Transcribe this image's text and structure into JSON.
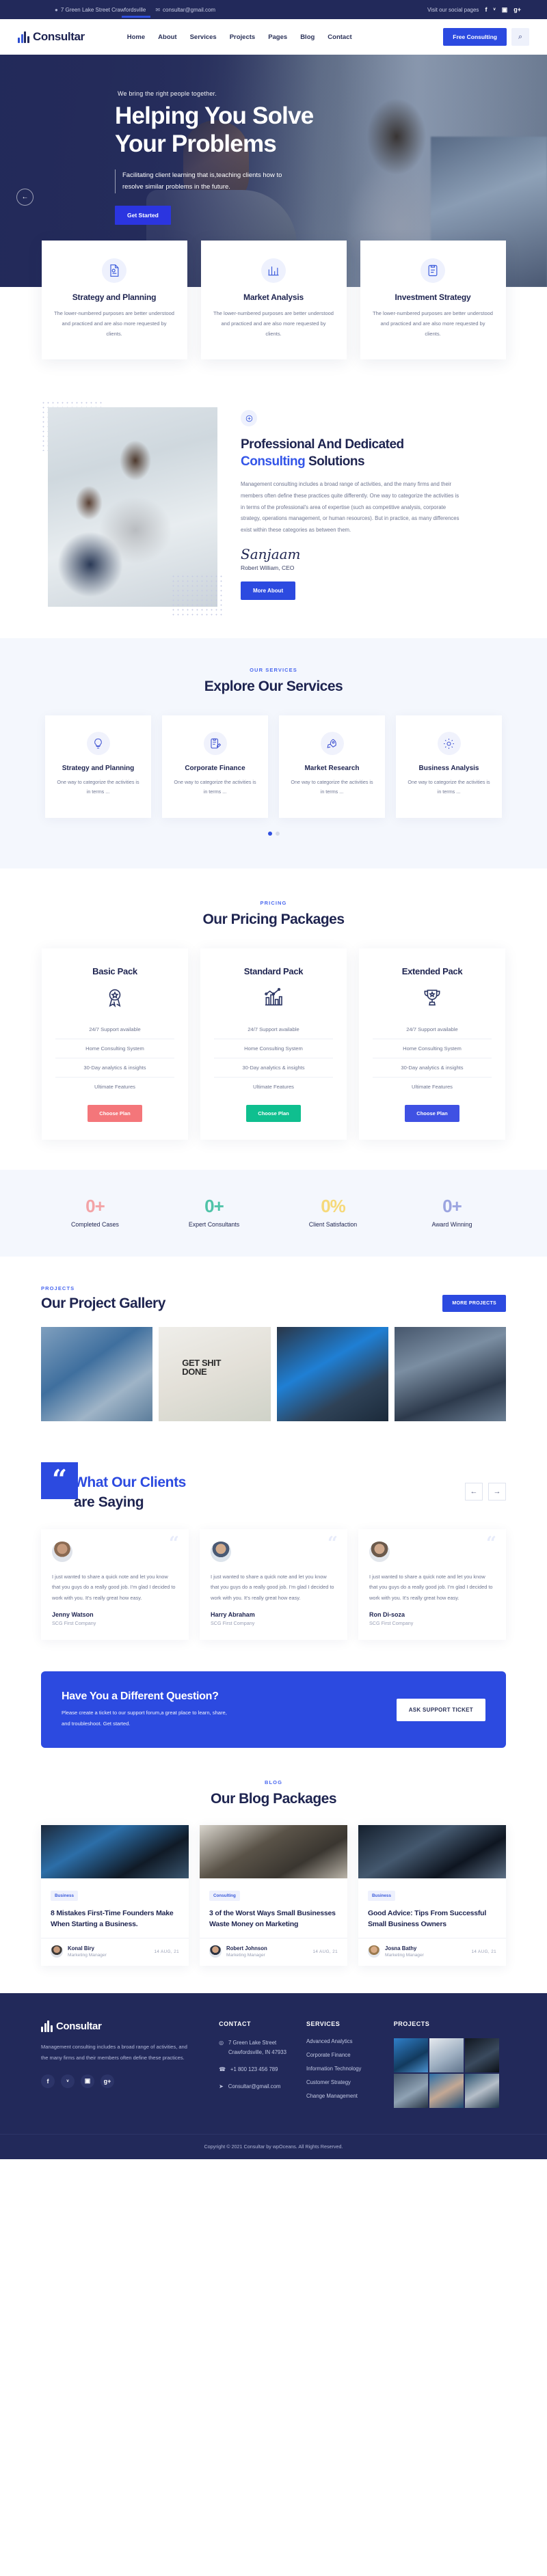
{
  "topbar": {
    "address": "7 Green Lake Street Crawfordsville",
    "email": "consultar@gmail.com",
    "social_label": "Visit our social pages",
    "social": [
      "f",
      "ᵛ",
      "▣",
      "g+"
    ]
  },
  "header": {
    "brand": "Consultar",
    "nav": [
      {
        "label": "Home",
        "active": true
      },
      {
        "label": "About",
        "active": false
      },
      {
        "label": "Services",
        "active": false
      },
      {
        "label": "Projects",
        "active": false
      },
      {
        "label": "Pages",
        "active": false
      },
      {
        "label": "Blog",
        "active": false
      },
      {
        "label": "Contact",
        "active": false
      }
    ],
    "cta": "Free Consulting",
    "search_icon": "⌕"
  },
  "hero": {
    "subtitle": "We bring the right people together.",
    "title_line1": "Helping You Solve",
    "title_line2": "Your Problems",
    "description": "Facilitating client learning that is,teaching clients how to resolve similar problems in the future.",
    "button": "Get Started",
    "prev_arrow": "←"
  },
  "features": [
    {
      "title": "Strategy and Planning",
      "text": "The lower-numbered purposes are better understood and practiced and are also more requested by clients.",
      "icon": "document-chart-icon"
    },
    {
      "title": "Market Analysis",
      "text": "The lower-numbered purposes are better understood and practiced and are also more requested by clients.",
      "icon": "bar-chart-icon"
    },
    {
      "title": "Investment Strategy",
      "text": "The lower-numbered purposes are better understood and practiced and are also more requested by clients.",
      "icon": "clipboard-icon"
    }
  ],
  "about": {
    "title_plain1": "Professional And Dedicated",
    "title_highlight": "Consulting",
    "title_plain2": " Solutions",
    "paragraph": "Management consulting includes a broad range of activities, and the many firms and their members often define these practices quite differently. One way to categorize the activities is in terms of the professional's area of expertise (such as competitive analysis, corporate strategy, operations management, or human resources). But in practice, as many differences exist within these categories as between them.",
    "signature": "Sanjaam",
    "signature_name": "Robert William, CEO",
    "button": "More About"
  },
  "services": {
    "eyebrow": "OUR SERVICES",
    "title": "Explore Our Services",
    "items": [
      {
        "title": "Strategy and Planning",
        "text": "One way to categorize the activities is in terms ...",
        "icon": "lightbulb-icon"
      },
      {
        "title": "Corporate Finance",
        "text": "One way to categorize the activities is in terms ...",
        "icon": "clipboard-pencil-icon"
      },
      {
        "title": "Market Research",
        "text": "One way to categorize the activities is in terms ...",
        "icon": "rocket-icon"
      },
      {
        "title": "Business Analysis",
        "text": "One way to categorize the activities is in terms ...",
        "icon": "gear-icon"
      }
    ]
  },
  "pricing": {
    "eyebrow": "PRICING",
    "title": "Our Pricing Packages",
    "plans": [
      {
        "name": "Basic Pack",
        "icon": "badge-star-icon",
        "features": [
          "24/7 Support available",
          "Home Consulting System",
          "30-Day analytics & insights",
          "Ultimate Features"
        ],
        "button": "Choose Plan",
        "color": "#f4767a"
      },
      {
        "name": "Standard Pack",
        "icon": "bar-chart-line-icon",
        "features": [
          "24/7 Support available",
          "Home Consulting System",
          "30-Day analytics & insights",
          "Ultimate Features"
        ],
        "button": "Choose Plan",
        "color": "#0fbf8f"
      },
      {
        "name": "Extended Pack",
        "icon": "trophy-icon",
        "features": [
          "24/7 Support available",
          "Home Consulting System",
          "30-Day analytics & insights",
          "Ultimate Features"
        ],
        "button": "Choose Plan",
        "color": "#3f51e3"
      }
    ]
  },
  "counters": [
    {
      "value": "0+",
      "label": "Completed Cases",
      "color": "#f3a3a6"
    },
    {
      "value": "0+",
      "label": "Expert Consultants",
      "color": "#4fc3a8"
    },
    {
      "value": "0%",
      "label": "Client Satisfaction",
      "color": "#f6d97a"
    },
    {
      "value": "0+",
      "label": "Award Winning",
      "color": "#9ba4e0"
    }
  ],
  "projects": {
    "eyebrow": "PROJECTS",
    "title": "Our Project Gallery",
    "button": "MORE PROJECTS"
  },
  "testimonials": {
    "quote_glyph": "“",
    "title_hl": "What Our Clients",
    "title_rest": "are Saying",
    "prev": "←",
    "next": "→",
    "items": [
      {
        "quote": "I just wanted to share a quick note and let you know that you guys do a really good job. I'm glad I decided to work with you. It's really great how easy.",
        "name": "Jenny Watson",
        "company": "SCG First Company"
      },
      {
        "quote": "I just wanted to share a quick note and let you know that you guys do a really good job. I'm glad I decided to work with you. It's really great how easy.",
        "name": "Harry Abraham",
        "company": "SCG First Company"
      },
      {
        "quote": "I just wanted to share a quick note and let you know that you guys do a really good job. I'm glad I decided to work with you. It's really great how easy.",
        "name": "Ron Di-soza",
        "company": "SCG First Company"
      }
    ]
  },
  "cta": {
    "title": "Have You a Different Question?",
    "text": "Please create a ticket to our support forum,a great place to learn, share, and troubleshoot. Get started.",
    "button": "ASK SUPPORT TICKET"
  },
  "blog": {
    "eyebrow": "BLOG",
    "title": "Our Blog Packages",
    "posts": [
      {
        "tag": "Business",
        "title": "8 Mistakes First-Time Founders Make When Starting a Business.",
        "author": "Konal Biry",
        "role": "Marketing Manager",
        "date": "14 AUG, 21"
      },
      {
        "tag": "Consulting",
        "title": "3 of the Worst Ways Small Businesses Waste Money on Marketing",
        "author": "Robert Johnson",
        "role": "Marketing Manager",
        "date": "14 AUG, 21"
      },
      {
        "tag": "Business",
        "title": "Good Advice: Tips From Successful Small Business Owners",
        "author": "Josna Bathy",
        "role": "Marketing Manager",
        "date": "14 AUG, 21"
      }
    ]
  },
  "footer": {
    "brand": "Consultar",
    "description": "Management consulting includes a broad range of activities, and the many firms and their members often define these practices.",
    "social": [
      "f",
      "ᵛ",
      "▣",
      "g+"
    ],
    "contact_head": "CONTACT",
    "contact": [
      {
        "icon": "location-icon",
        "text": "7 Green Lake Street Crawfordsville, IN 47933"
      },
      {
        "icon": "phone-icon",
        "text": "+1 800 123 456 789"
      },
      {
        "icon": "send-icon",
        "text": "Consultar@gmail.com"
      }
    ],
    "services_head": "SERVICES",
    "services": [
      "Advanced Analytics",
      "Corporate Finance",
      "Information Technology",
      "Customer Strategy",
      "Change Management"
    ],
    "projects_head": "PROJECTS",
    "copyright": "Copyright © 2021 Consultar by wpOceans. All Rights Reserved."
  }
}
